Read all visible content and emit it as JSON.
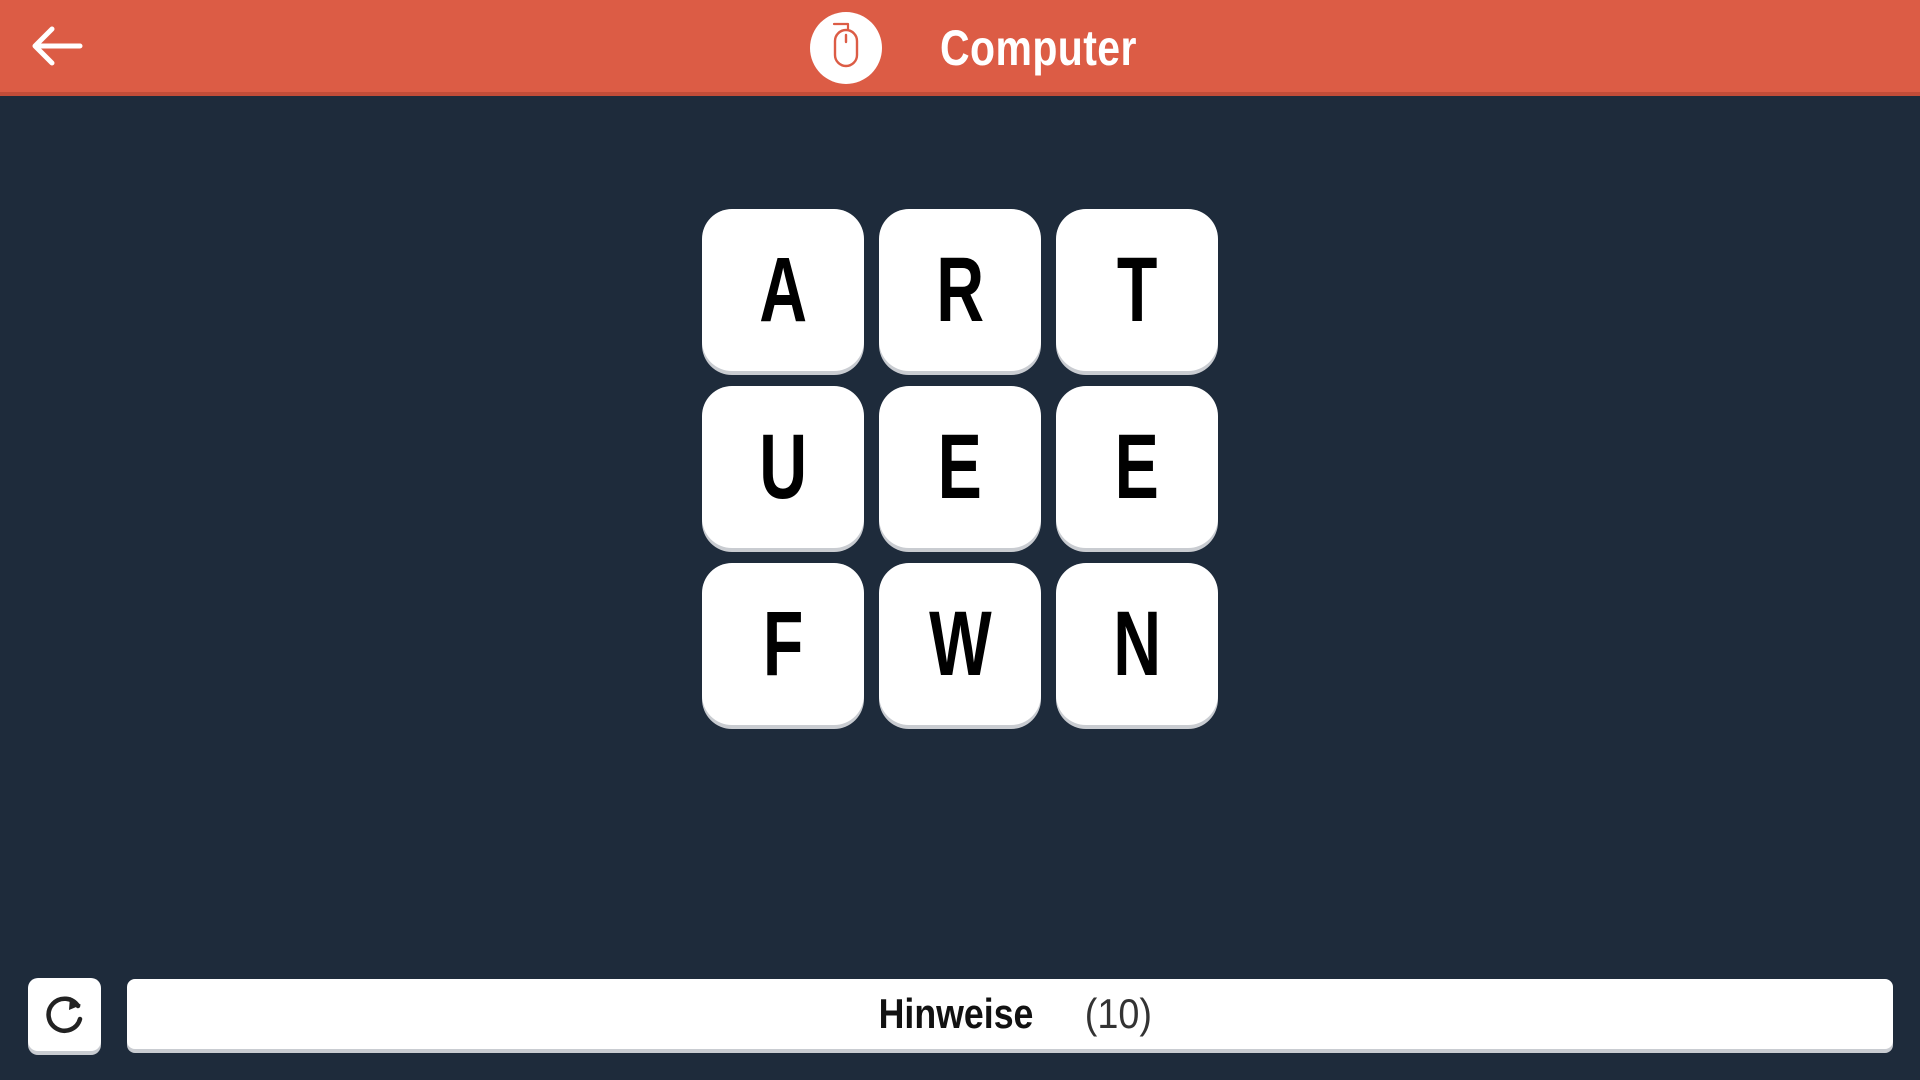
{
  "header": {
    "title": "Computer",
    "back_icon": "arrow-left-icon",
    "category_icon": "mouse-icon",
    "background_color": "#dc5c45"
  },
  "board": {
    "rows": [
      [
        "A",
        "R",
        "T"
      ],
      [
        "U",
        "E",
        "E"
      ],
      [
        "F",
        "W",
        "N"
      ]
    ],
    "tile_color": "#ffffff",
    "background_color": "#1e2b3b"
  },
  "footer": {
    "reset_icon": "reset-icon",
    "hint_label": "Hinweise",
    "hint_count": "(10)"
  }
}
